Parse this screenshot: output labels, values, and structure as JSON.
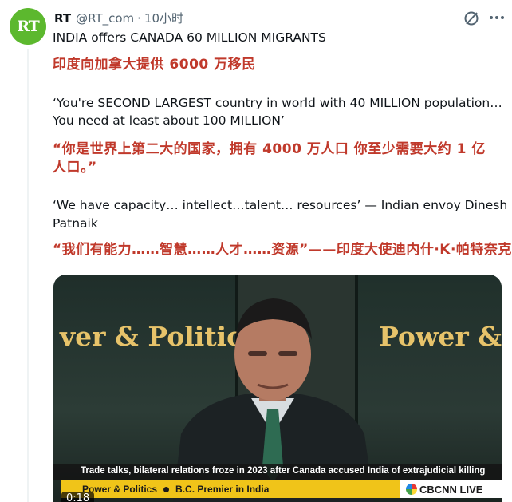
{
  "tweet": {
    "author_name": "RT",
    "handle": "@RT_com",
    "separator": "·",
    "time": "10小时",
    "avatar_text": "RT",
    "lines": [
      {
        "text": "INDIA offers CANADA 60 MILLION MIGRANTS"
      },
      {
        "text": "印度向加拿大提供 6000 万移民"
      },
      {
        "text": "‘You're SECOND LARGEST country in world with 40 MILLION population…"
      },
      {
        "text": "You need at least about 100 MILLION’"
      },
      {
        "text": "“你是世界上第二大的国家，拥有 4000 万人口      你至少需要大约 1 亿"
      },
      {
        "text": "人口。”"
      },
      {
        "text": "‘We have capacity… intellect…talent… resources’ — Indian envoy Dinesh K."
      },
      {
        "text": "Patnaik"
      },
      {
        "text": "“我们有能力……智慧……人才……资源”——印度大使迪内什·K·帕特奈克"
      }
    ]
  },
  "video": {
    "brand_left": "ver & Politic",
    "brand_right": "Power &",
    "caption": "Trade talks, bilateral relations froze in 2023 after Canada accused India of extrajudicial killing",
    "show_name": "Power & Politics",
    "topic": "B.C. Premier in India",
    "network": "CBCNN LIVE",
    "timestamp": "0:18"
  },
  "colors": {
    "accent_red": "#c0392b",
    "avatar_green": "#5cb82e",
    "lower_third_yellow": "#f0c419"
  },
  "icons": [
    "grok-icon",
    "more-icon",
    "cbc-logo-icon"
  ]
}
